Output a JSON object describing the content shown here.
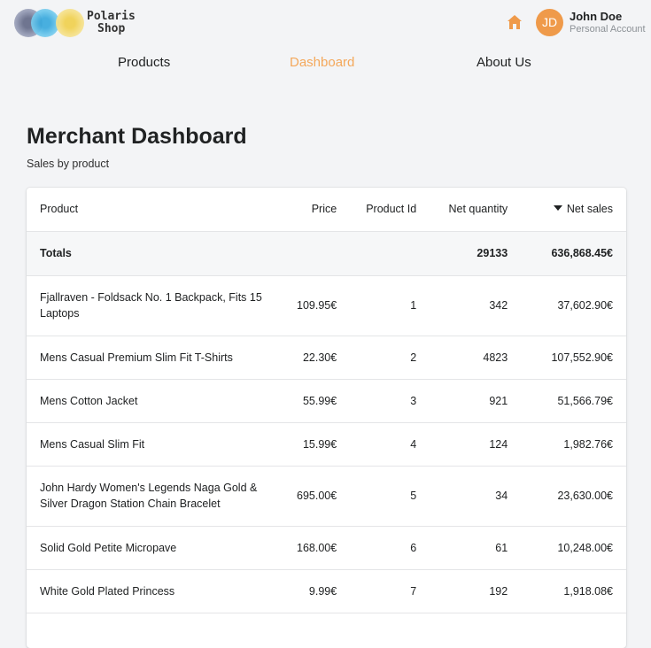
{
  "brand": {
    "line1": "Polaris",
    "line2": "Shop",
    "colors": [
      "#7c8199",
      "#45b3e2",
      "#f2d55c"
    ]
  },
  "header": {
    "home_icon": "home-icon",
    "avatar_initials": "JD",
    "user_name": "John Doe",
    "user_role": "Personal Account",
    "accent": "#ef9a4a"
  },
  "nav": {
    "items": [
      {
        "label": "Products",
        "active": false
      },
      {
        "label": "Dashboard",
        "active": true
      },
      {
        "label": "About Us",
        "active": false
      }
    ],
    "active_color": "#f4a85b"
  },
  "page": {
    "title": "Merchant Dashboard",
    "subtitle": "Sales by product"
  },
  "table": {
    "columns": [
      "Product",
      "Price",
      "Product Id",
      "Net quantity",
      "Net sales"
    ],
    "sorted_column": "Net sales",
    "totals": {
      "label": "Totals",
      "net_quantity": "29133",
      "net_sales": "636,868.45€"
    },
    "rows": [
      {
        "product": "Fjallraven - Foldsack No. 1 Backpack, Fits 15 Laptops",
        "price": "109.95€",
        "id": "1",
        "qty": "342",
        "sales": "37,602.90€"
      },
      {
        "product": "Mens Casual Premium Slim Fit T-Shirts",
        "price": "22.30€",
        "id": "2",
        "qty": "4823",
        "sales": "107,552.90€"
      },
      {
        "product": "Mens Cotton Jacket",
        "price": "55.99€",
        "id": "3",
        "qty": "921",
        "sales": "51,566.79€"
      },
      {
        "product": "Mens Casual Slim Fit",
        "price": "15.99€",
        "id": "4",
        "qty": "124",
        "sales": "1,982.76€"
      },
      {
        "product": "John Hardy Women's Legends Naga Gold & Silver Dragon Station Chain Bracelet",
        "price": "695.00€",
        "id": "5",
        "qty": "34",
        "sales": "23,630.00€"
      },
      {
        "product": "Solid Gold Petite Micropave",
        "price": "168.00€",
        "id": "6",
        "qty": "61",
        "sales": "10,248.00€"
      },
      {
        "product": "White Gold Plated Princess",
        "price": "9.99€",
        "id": "7",
        "qty": "192",
        "sales": "1,918.08€"
      }
    ]
  }
}
